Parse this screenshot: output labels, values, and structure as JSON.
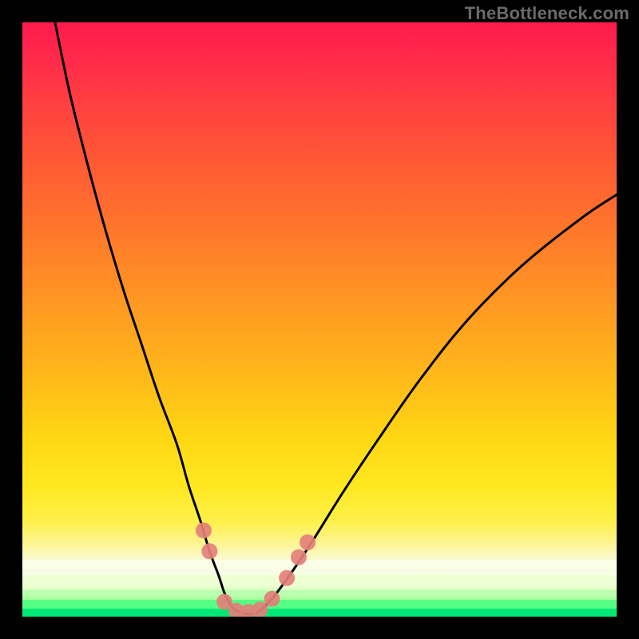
{
  "watermark": "TheBottleneck.com",
  "chart_data": {
    "type": "line",
    "title": "",
    "xlabel": "",
    "ylabel": "",
    "xlim": [
      0,
      100
    ],
    "ylim": [
      0,
      100
    ],
    "grid": false,
    "legend": "none",
    "background": {
      "direction": "vertical",
      "stops": [
        {
          "pos": 0.0,
          "color": "#ff1a4d"
        },
        {
          "pos": 0.3,
          "color": "#ff6a30"
        },
        {
          "pos": 0.6,
          "color": "#ffba1a"
        },
        {
          "pos": 0.8,
          "color": "#ffe820"
        },
        {
          "pos": 0.92,
          "color": "#f8ffe0"
        },
        {
          "pos": 0.98,
          "color": "#60ff80"
        },
        {
          "pos": 1.0,
          "color": "#00e874"
        }
      ]
    },
    "series": [
      {
        "name": "left-branch",
        "x": [
          5.5,
          8,
          11,
          14,
          17,
          20,
          23,
          26,
          28,
          30,
          31.5,
          33,
          34,
          35,
          36
        ],
        "y": [
          100,
          88,
          76,
          65,
          55,
          46,
          37,
          29,
          22,
          16,
          11,
          7,
          4,
          2,
          1
        ]
      },
      {
        "name": "right-branch",
        "x": [
          40,
          42,
          45,
          49,
          54,
          60,
          67,
          75,
          84,
          94,
          100
        ],
        "y": [
          1,
          3,
          7,
          13,
          21,
          30,
          40,
          50,
          59,
          67,
          71
        ]
      },
      {
        "name": "valley-floor",
        "x": [
          36,
          37.5,
          39,
          40
        ],
        "y": [
          1,
          0.5,
          0.5,
          1
        ]
      }
    ],
    "markers": [
      {
        "name": "marker-left-1",
        "x": 30.5,
        "y": 14.5
      },
      {
        "name": "marker-left-2",
        "x": 31.5,
        "y": 11.0
      },
      {
        "name": "marker-valley-1",
        "x": 34.0,
        "y": 2.5
      },
      {
        "name": "marker-valley-2",
        "x": 36.0,
        "y": 1.0
      },
      {
        "name": "marker-valley-3",
        "x": 38.0,
        "y": 0.8
      },
      {
        "name": "marker-valley-4",
        "x": 40.0,
        "y": 1.2
      },
      {
        "name": "marker-valley-5",
        "x": 42.0,
        "y": 3.0
      },
      {
        "name": "marker-right-1",
        "x": 44.5,
        "y": 6.5
      },
      {
        "name": "marker-right-2",
        "x": 46.5,
        "y": 10.0
      },
      {
        "name": "marker-right-3",
        "x": 48.0,
        "y": 12.5
      }
    ],
    "marker_style": {
      "r": 10,
      "fill": "#e38079",
      "opacity": 0.92
    }
  }
}
